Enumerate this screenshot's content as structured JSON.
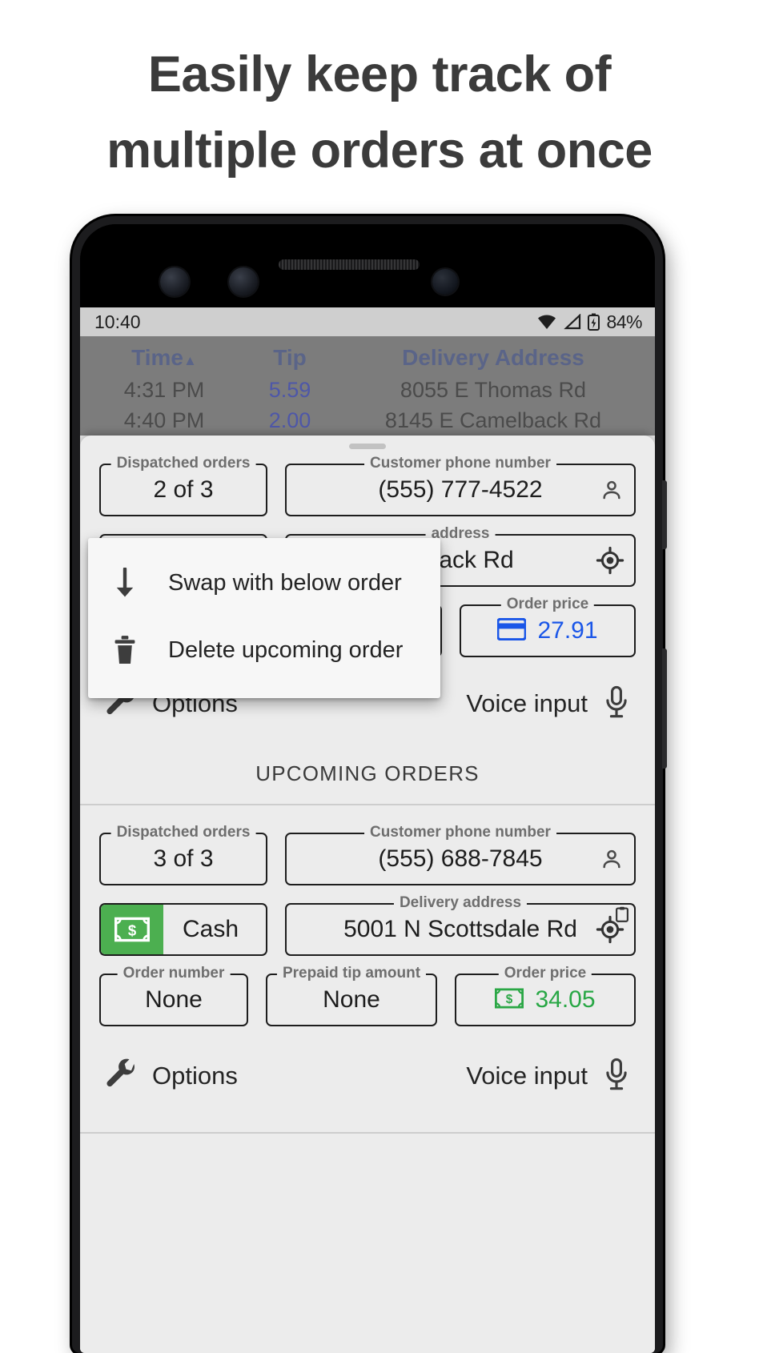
{
  "headline": {
    "line1": "Easily keep track of",
    "line2": "multiple orders at once"
  },
  "status_bar": {
    "time": "10:40",
    "battery": "84%",
    "icons": [
      "wifi-icon",
      "cellular-signal-icon",
      "battery-icon"
    ]
  },
  "orders_table": {
    "columns": [
      "Time",
      "Tip",
      "Delivery Address"
    ],
    "sort_indicator": "▲",
    "rows": [
      {
        "time": "4:31 PM",
        "tip": "5.59",
        "address": "8055 E Thomas Rd"
      },
      {
        "time": "4:40 PM",
        "tip": "2.00",
        "address": "8145 E Camelback Rd"
      }
    ]
  },
  "active_order": {
    "dispatched_label": "Dispatched orders",
    "dispatched_value": "2 of 3",
    "phone_label": "Customer phone number",
    "phone_value": "(555) 777-4522",
    "address_label": "address",
    "address_value": "elback Rd",
    "price_label": "Order price",
    "price_value": "27.91",
    "price_icon": "credit-card-icon",
    "price_color": "#1a56e8"
  },
  "popup_menu": {
    "items": [
      {
        "icon": "arrow-down-icon",
        "label": "Swap with below order"
      },
      {
        "icon": "trash-icon",
        "label": "Delete upcoming order"
      }
    ]
  },
  "options_bar": {
    "options_label": "Options",
    "options_icon": "wrench-icon",
    "voice_label": "Voice input",
    "voice_icon": "microphone-icon"
  },
  "section": {
    "upcoming_title": "UPCOMING ORDERS"
  },
  "upcoming_order": {
    "dispatched_label": "Dispatched orders",
    "dispatched_value": "3 of 3",
    "phone_label": "Customer phone number",
    "phone_value": "(555) 688-7845",
    "payment_label": "Cash",
    "payment_icon": "cash-money-icon",
    "payment_color": "#4caf50",
    "address_label": "Delivery address",
    "address_value": "5001 N Scottsdale Rd",
    "order_number_label": "Order number",
    "order_number_value": "None",
    "prepaid_tip_label": "Prepaid tip amount",
    "prepaid_tip_value": "None",
    "price_label": "Order price",
    "price_value": "34.05",
    "price_icon": "cash-money-icon",
    "price_color": "#2aa745"
  },
  "options_bar_2": {
    "options_label": "Options",
    "options_icon": "wrench-icon",
    "voice_label": "Voice input",
    "voice_icon": "microphone-icon"
  }
}
